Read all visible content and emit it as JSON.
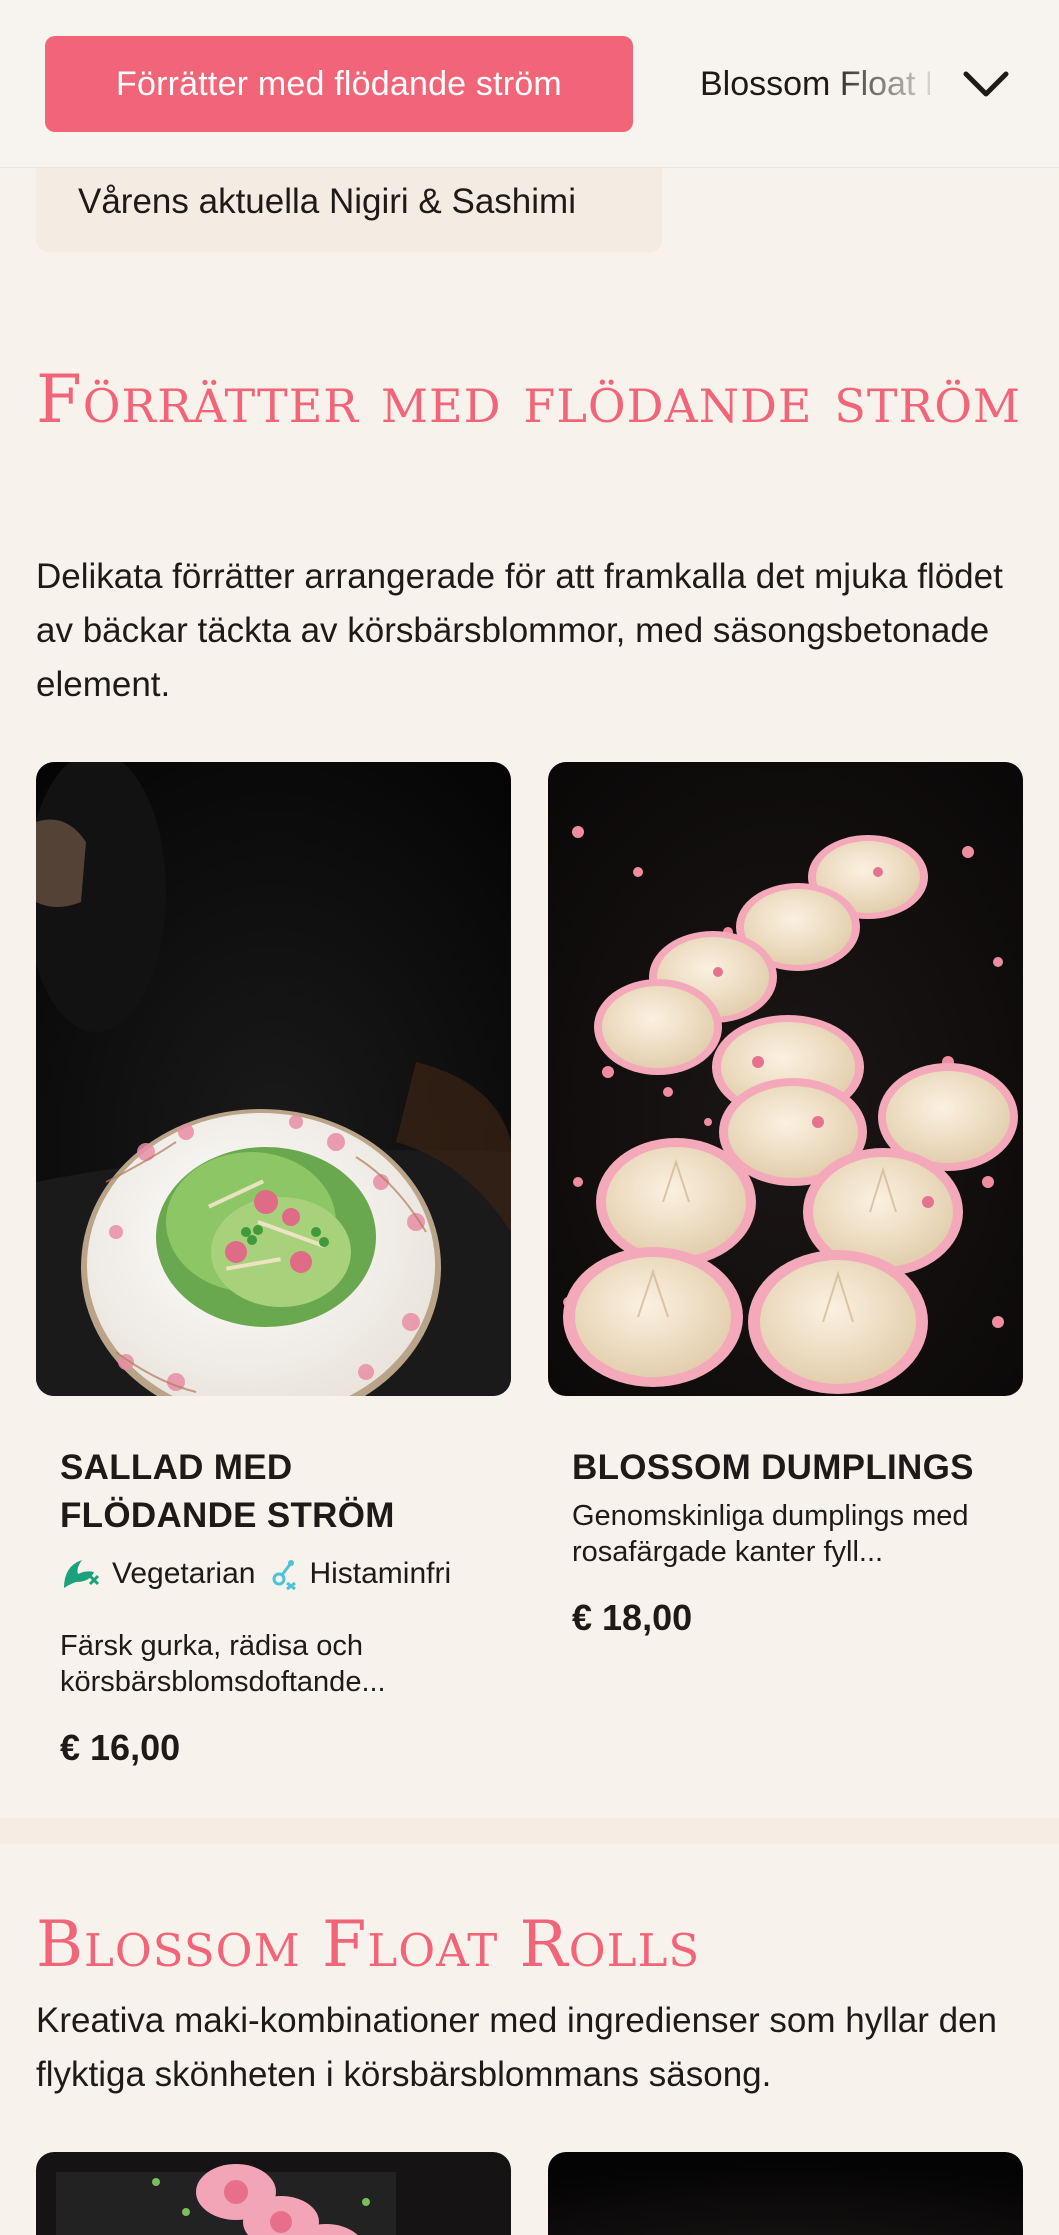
{
  "category_bar": {
    "active_label": "Förrätter med flödande ström",
    "next_label": "Blossom Float Rolls",
    "expand_icon": "chevron-down-icon"
  },
  "subcategory": {
    "label": "Vårens aktuella Nigiri & Sashimi"
  },
  "section1": {
    "title": "Förrätter med flödande ström",
    "description": "Delikata förrätter arrangerade för att framkalla det mjuka flödet av bäckar täckta av körsbärsblommor, med säsongsbetonade element."
  },
  "items": [
    {
      "name": "Sallad med flödande ström",
      "tags": [
        {
          "icon": "vegetarian-icon",
          "label": "Vegetarian"
        },
        {
          "icon": "histamine-free-icon",
          "label": "Histaminfri"
        }
      ],
      "description": "Färsk gurka, rädisa och körsbärsblomsdoftande...",
      "price": "€ 16,00"
    },
    {
      "name": "Blossom Dumplings",
      "tags": [],
      "description": "Genomskinliga dumplings med rosafärgade kanter fyll...",
      "price": "€ 18,00"
    }
  ],
  "section2": {
    "title": "Blossom Float Rolls",
    "description": "Kreativa maki-kombinationer med ingredienser som hyllar den flyktiga skönheten i körsbärsblommans säsong."
  },
  "colors": {
    "accent": "#f26477",
    "background": "#f7f2ec",
    "text": "#1f1a17",
    "vegetarian_icon": "#1aa37a",
    "histamine_icon": "#4cc3d9"
  }
}
